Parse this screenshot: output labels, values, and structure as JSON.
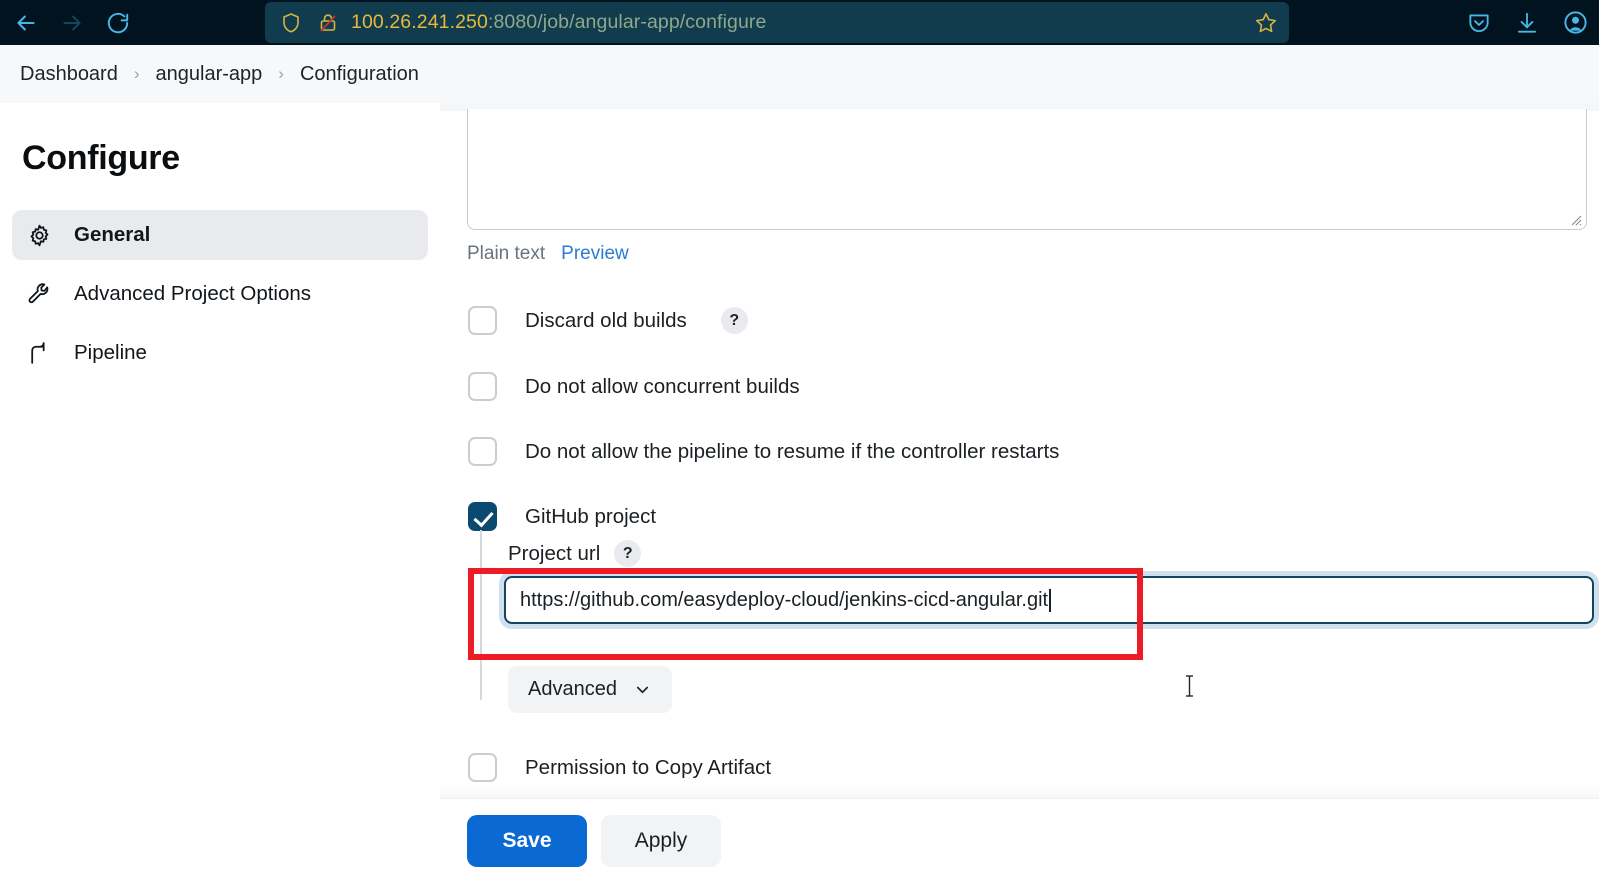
{
  "browser": {
    "nav": {
      "back": "back-arrow",
      "forward": "forward-arrow",
      "reload": "reload"
    },
    "url": {
      "host": "100.26.241.250",
      "path": ":8080/job/angular-app/configure",
      "full": "100.26.241.250:8080/job/angular-app/configure",
      "shield_icon": "tracking-protection-shield",
      "lock_icon": "insecure-connection-lock",
      "bookmark_icon": "star"
    },
    "toolbar_icons": [
      "pocket-icon",
      "downloads-icon",
      "account-icon"
    ]
  },
  "breadcrumb": {
    "items": [
      {
        "label": "Dashboard"
      },
      {
        "label": "angular-app"
      },
      {
        "label": "Configuration"
      }
    ],
    "separator": "›"
  },
  "sidebar": {
    "title": "Configure",
    "items": [
      {
        "label": "General",
        "icon": "gear-icon",
        "active": true
      },
      {
        "label": "Advanced Project Options",
        "icon": "wrench-icon",
        "active": false
      },
      {
        "label": "Pipeline",
        "icon": "pipeline-icon",
        "active": false
      }
    ]
  },
  "main": {
    "description": {
      "value": "",
      "plain_text_label": "Plain text",
      "preview_label": "Preview"
    },
    "checkboxes": [
      {
        "label": "Discard old builds",
        "checked": false,
        "help": "?"
      },
      {
        "label": "Do not allow concurrent builds",
        "checked": false,
        "help": ""
      },
      {
        "label": "Do not allow the pipeline to resume if the controller restarts",
        "checked": false,
        "help": ""
      },
      {
        "label": "GitHub project",
        "checked": true,
        "help": ""
      }
    ],
    "github_project": {
      "project_url_label": "Project url",
      "project_url_help": "?",
      "project_url_value": "https://github.com/easydeploy-cloud/jenkins-cicd-angular.git",
      "project_url_placeholder": "",
      "advanced_label": "Advanced",
      "advanced_chevron": "chevron-down-icon"
    },
    "permission_checkbox": {
      "label": "Permission to Copy Artifact",
      "checked": false
    }
  },
  "footer": {
    "save_label": "Save",
    "apply_label": "Apply"
  },
  "annotation": {
    "highlight_color": "#ed1c24",
    "target": "project-url-input"
  },
  "colors": {
    "chrome_bg": "#021320",
    "urlbar_bg": "#103c4d",
    "url_host": "#e8b93b",
    "breadcrumb_bg": "#f7f8f9",
    "checkbox_checked": "#0b4a6e",
    "save_button": "#0b69d4",
    "focus_ring": "#cfe0ee",
    "link": "#2b7cd3"
  }
}
